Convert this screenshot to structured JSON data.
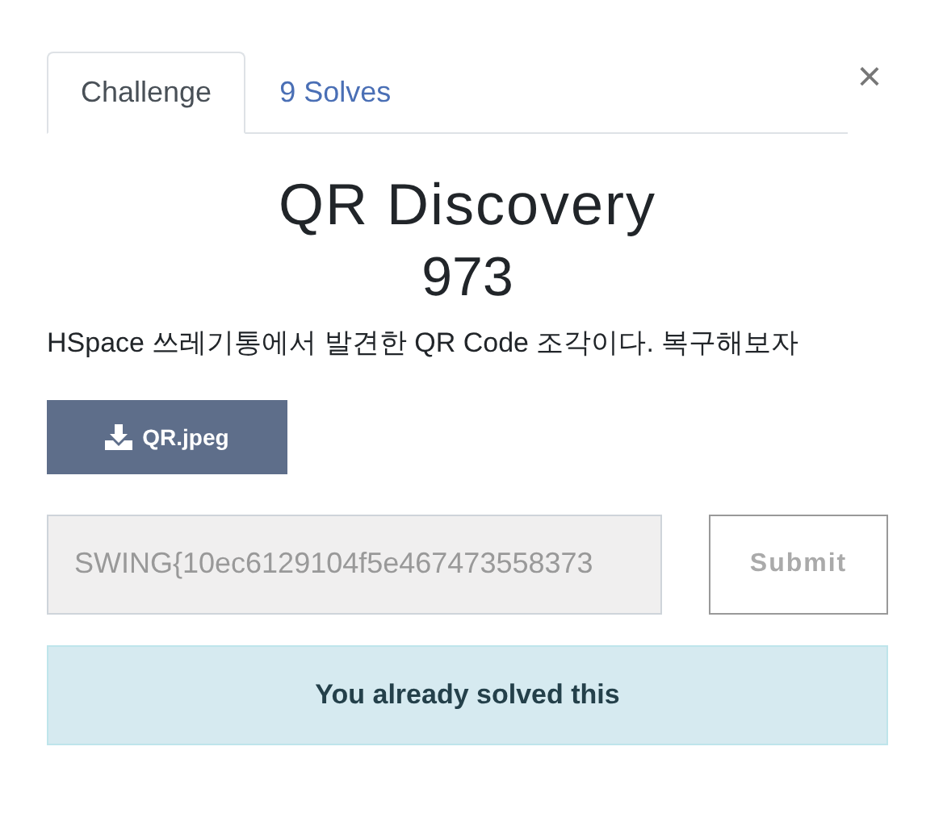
{
  "tabs": [
    {
      "label": "Challenge",
      "selected": true
    },
    {
      "label": "9 Solves",
      "selected": false
    }
  ],
  "close": "×",
  "challenge": {
    "name": "QR Discovery",
    "value": "973",
    "description": "HSpace 쓰레기통에서 발견한 QR Code 조각이다. 복구해보자"
  },
  "files": [
    {
      "name": "QR.jpeg"
    }
  ],
  "flag": {
    "value": "SWING{10ec6129104f5e467473558373",
    "disabled": true
  },
  "submit": {
    "label": "Submit",
    "disabled": true
  },
  "alert": "You already solved this"
}
